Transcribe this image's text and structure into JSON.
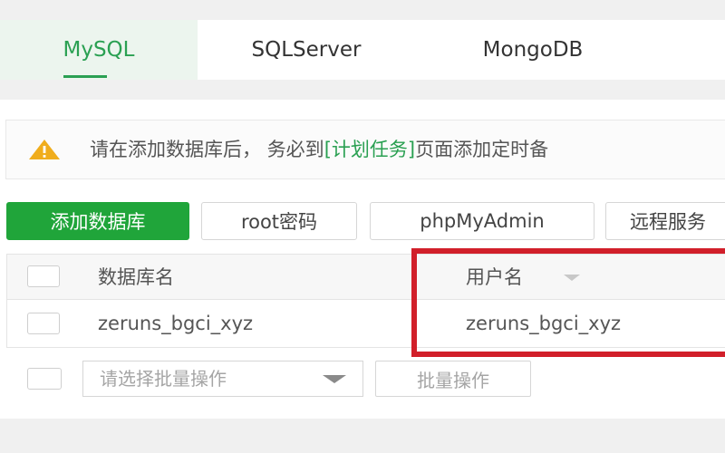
{
  "tabs": [
    {
      "label": "MySQL",
      "active": true
    },
    {
      "label": "SQLServer",
      "active": false
    },
    {
      "label": "MongoDB",
      "active": false
    }
  ],
  "alert": {
    "icon": "warning-icon",
    "text_before": "请在添加数据库后， 务必到",
    "link_text": "[计划任务]",
    "text_after": "页面添加定时备"
  },
  "toolbar": {
    "add_label": "添加数据库",
    "root_label": "root密码",
    "pma_label": "phpMyAdmin",
    "remote_label": "远程服务"
  },
  "table": {
    "headers": {
      "name": "数据库名",
      "user": "用户名"
    },
    "rows": [
      {
        "name": "zeruns_bgci_xyz",
        "user": "zeruns_bgci_xyz"
      }
    ]
  },
  "footer": {
    "batch_placeholder": "请选择批量操作",
    "batch_button": "批量操作"
  },
  "colors": {
    "accent": "#20a53a",
    "highlight": "#d11f2a",
    "warning": "#f0ad1c"
  }
}
